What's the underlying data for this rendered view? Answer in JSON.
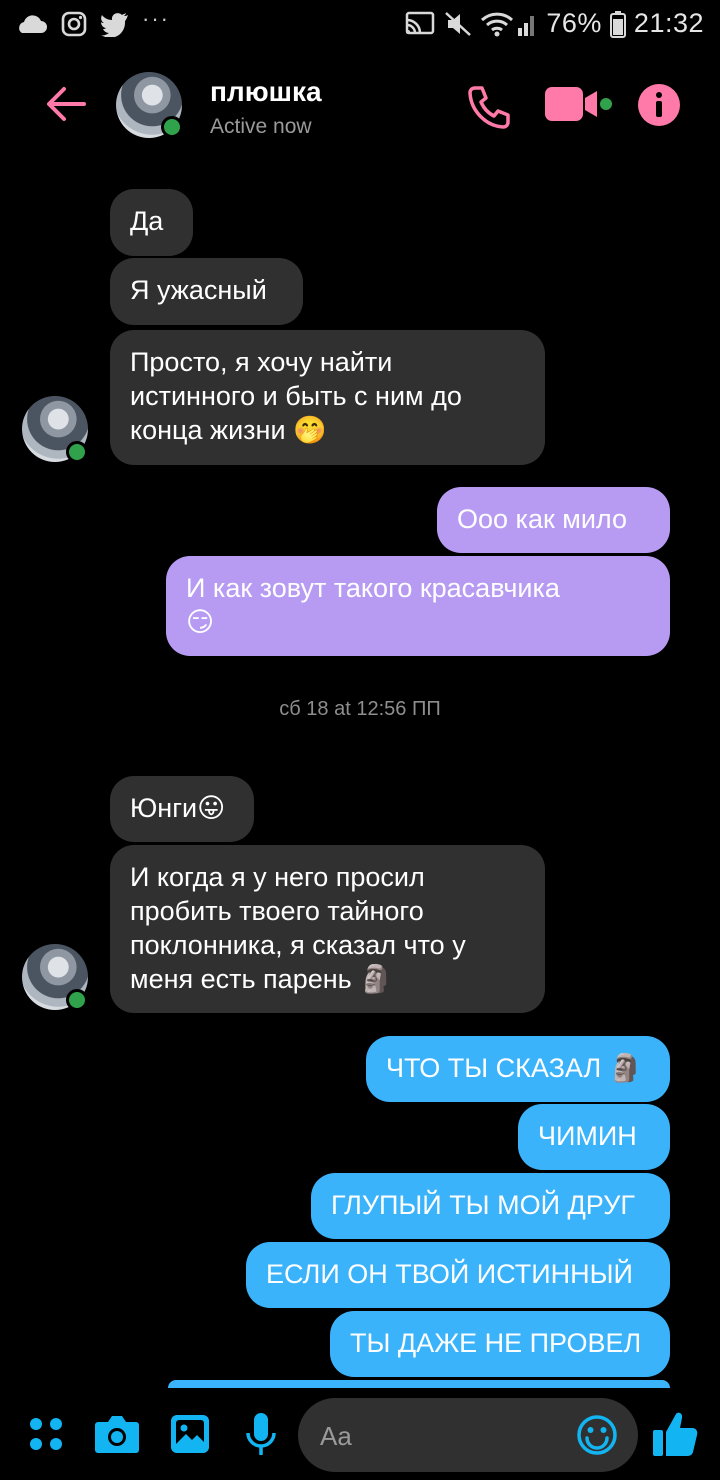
{
  "status_bar": {
    "battery": "76%",
    "time": "21:32",
    "dots": "···"
  },
  "header": {
    "name": "плюшка",
    "status": "Active now"
  },
  "messages": [
    {
      "text": "Да"
    },
    {
      "text": "Я ужасный"
    },
    {
      "text": "Просто, я хочу найти\nистинного и быть с ним до\nконца жизни 🤭"
    },
    {
      "text": "Ооо как мило"
    },
    {
      "text": "И как зовут такого красавчика\n😏"
    },
    {
      "text": "Юнги😛"
    },
    {
      "text": "И когда я у него просил\nпробить твоего тайного\nпоклонника, я сказал что у\nменя есть парень 🗿"
    },
    {
      "text": "ЧТО ТЫ СКАЗАЛ 🗿"
    },
    {
      "text": "ЧИМИН"
    },
    {
      "text": "ГЛУПЫЙ ТЫ МОЙ ДРУГ"
    },
    {
      "text": "ЕСЛИ ОН ТВОЙ ИСТИННЫЙ"
    },
    {
      "text": "ТЫ ДАЖЕ НЕ ПРОВЕЛ"
    }
  ],
  "timestamp": "сб 18 at 12:56 ПП",
  "composer": {
    "placeholder": "Aa"
  },
  "colors": {
    "accent_pink": "#ff7aa8",
    "incoming_bubble": "#303030",
    "outgoing_purple": "#b79bf2",
    "outgoing_blue": "#3bb3fb",
    "bottom_icons": "#12b5f2"
  }
}
